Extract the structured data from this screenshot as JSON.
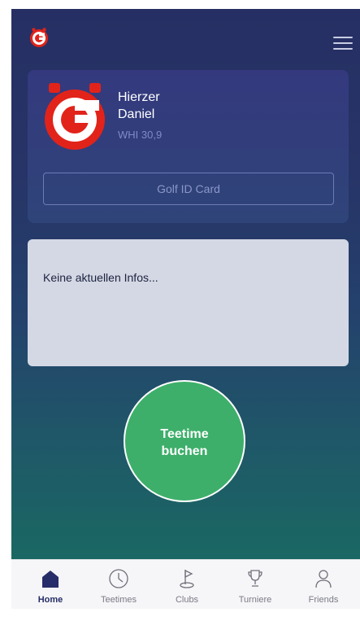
{
  "profile": {
    "last_name": "Hierzer",
    "first_name": "Daniel",
    "whi": "WHI 30,9",
    "id_card_label": "Golf ID Card"
  },
  "info": {
    "text": "Keine aktuellen Infos..."
  },
  "booking": {
    "line1": "Teetime",
    "line2": "buchen"
  },
  "tabs": [
    {
      "label": "Home",
      "icon": "home-icon",
      "active": true
    },
    {
      "label": "Teetimes",
      "icon": "clock-icon",
      "active": false
    },
    {
      "label": "Clubs",
      "icon": "golf-flag-icon",
      "active": false
    },
    {
      "label": "Turniere",
      "icon": "trophy-icon",
      "active": false
    },
    {
      "label": "Friends",
      "icon": "person-icon",
      "active": false
    }
  ],
  "colors": {
    "brand_red": "#e2231a",
    "accent_green": "#3daf6a",
    "navy": "#272d68"
  }
}
